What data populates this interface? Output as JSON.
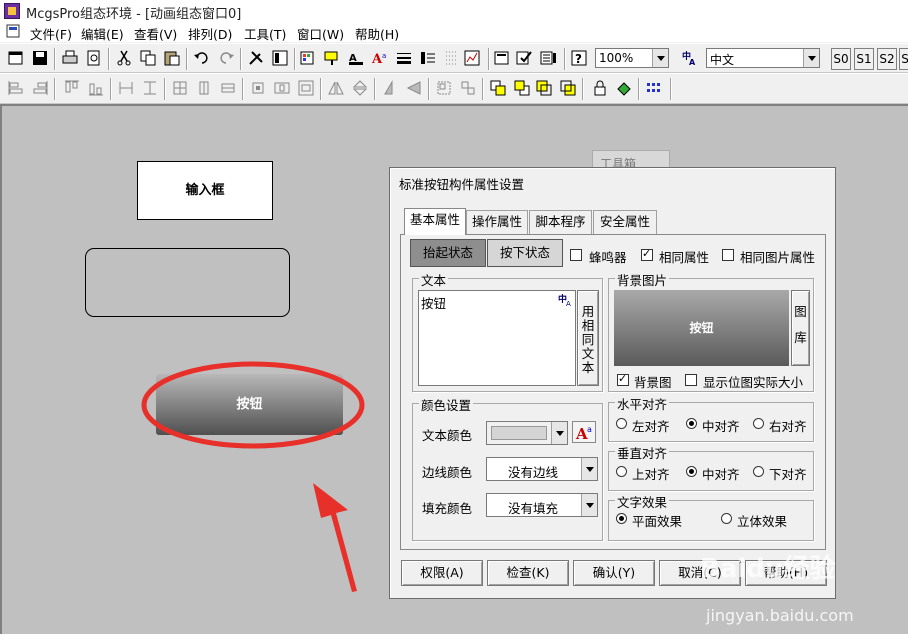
{
  "window": {
    "title": "McgsPro组态环境 - [动画组态窗口0]"
  },
  "menu": [
    "文件(F)",
    "编辑(E)",
    "查看(V)",
    "排列(D)",
    "工具(T)",
    "窗口(W)",
    "帮助(H)"
  ],
  "toolbar": {
    "zoom_value": "100%",
    "language_value": "中文",
    "state_buttons": [
      "S0",
      "S1",
      "S2",
      "S"
    ]
  },
  "canvas": {
    "input_box_label": "输入框",
    "button_label": "按钮",
    "toolbox_label": "工具箱"
  },
  "annotation_color": "#e8302a",
  "dialog": {
    "title": "标准按钮构件属性设置",
    "tabs": [
      "基本属性",
      "操作属性",
      "脚本程序",
      "安全属性"
    ],
    "state_up": "抬起状态",
    "state_down": "按下状态",
    "buzzer_label": "蜂鸣器",
    "buzzer_checked": false,
    "same_attr_label": "相同属性",
    "same_attr_checked": true,
    "same_image_label": "相同图片属性",
    "same_image_checked": false,
    "text_group": {
      "title": "文本",
      "content": "按钮",
      "same_text_button": "用相同文本"
    },
    "bg_group": {
      "title": "背景图片",
      "preview_label": "按钮",
      "library_button": "图库",
      "bg_image_label": "背景图",
      "bg_image_checked": true,
      "actual_size_label": "显示位图实际大小",
      "actual_size_checked": false
    },
    "color_group": {
      "title": "颜色设置",
      "text_color_label": "文本颜色",
      "border_color_label": "边线颜色",
      "border_color_value": "没有边线",
      "fill_color_label": "填充颜色",
      "fill_color_value": "没有填充"
    },
    "halign": {
      "title": "水平对齐",
      "options": [
        "左对齐",
        "中对齐",
        "右对齐"
      ],
      "selected": 1
    },
    "valign": {
      "title": "垂直对齐",
      "options": [
        "上对齐",
        "中对齐",
        "下对齐"
      ],
      "selected": 1
    },
    "effect": {
      "title": "文字效果",
      "options": [
        "平面效果",
        "立体效果"
      ],
      "selected": 0
    },
    "buttons": [
      "权限(A)",
      "检查(K)",
      "确认(Y)",
      "取消(C)",
      "帮助(H)"
    ]
  },
  "watermark": {
    "brand": "Baidu经验",
    "url": "jingyan.baidu.com"
  }
}
